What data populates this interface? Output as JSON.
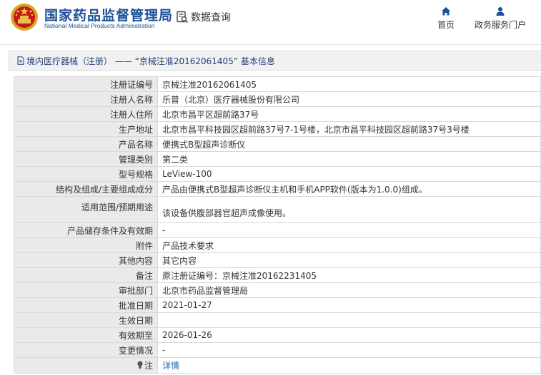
{
  "header": {
    "logo_cn": "国家药品监督管理局",
    "logo_en": "National Medical Products Administration",
    "query_label": "数据查询",
    "nav": [
      {
        "label": "首页",
        "icon": "home-icon"
      },
      {
        "label": "政务服务门户",
        "icon": "user-icon"
      }
    ]
  },
  "titlebar": {
    "text": "境内医疗器械（注册） —— “京械注准20162061405” 基本信息"
  },
  "rows": [
    {
      "label": "注册证编号",
      "value": "京械注准20162061405"
    },
    {
      "label": "注册人名称",
      "value": "乐普（北京）医疗器械股份有限公司"
    },
    {
      "label": "注册人住所",
      "value": "北京市昌平区超前路37号"
    },
    {
      "label": "生产地址",
      "value": "北京市昌平科技园区超前路37号7-1号楼，北京市昌平科技园区超前路37号3号楼"
    },
    {
      "label": "产品名称",
      "value": "便携式B型超声诊断仪"
    },
    {
      "label": "管理类别",
      "value": "第二类"
    },
    {
      "label": "型号规格",
      "value": "LeView-100"
    },
    {
      "label": "结构及组成/主要组成成分",
      "value": "产品由便携式B型超声诊断仪主机和手机APP软件(版本为1.0.0)组成。"
    },
    {
      "label": "适用范围/预期用途",
      "value": "该设备供腹部器官超声成像使用。"
    },
    {
      "label": "产品储存条件及有效期",
      "value": "-"
    },
    {
      "label": "附件",
      "value": "产品技术要求"
    },
    {
      "label": "其他内容",
      "value": "其它内容"
    },
    {
      "label": "备注",
      "value": "原注册证编号：京械注准20162231405"
    },
    {
      "label": "审批部门",
      "value": "北京市药品监督管理局"
    },
    {
      "label": "批准日期",
      "value": "2021-01-27"
    },
    {
      "label": "生效日期",
      "value": ""
    },
    {
      "label": "有效期至",
      "value": "2026-01-26"
    },
    {
      "label": "变更情况",
      "value": "-"
    }
  ],
  "note_row": {
    "label": "注",
    "link": "详情"
  },
  "colors": {
    "brand": "#1d4f97",
    "link": "#1a66b3",
    "label_bg": "#eaeaea",
    "border": "#d9d9d9"
  }
}
